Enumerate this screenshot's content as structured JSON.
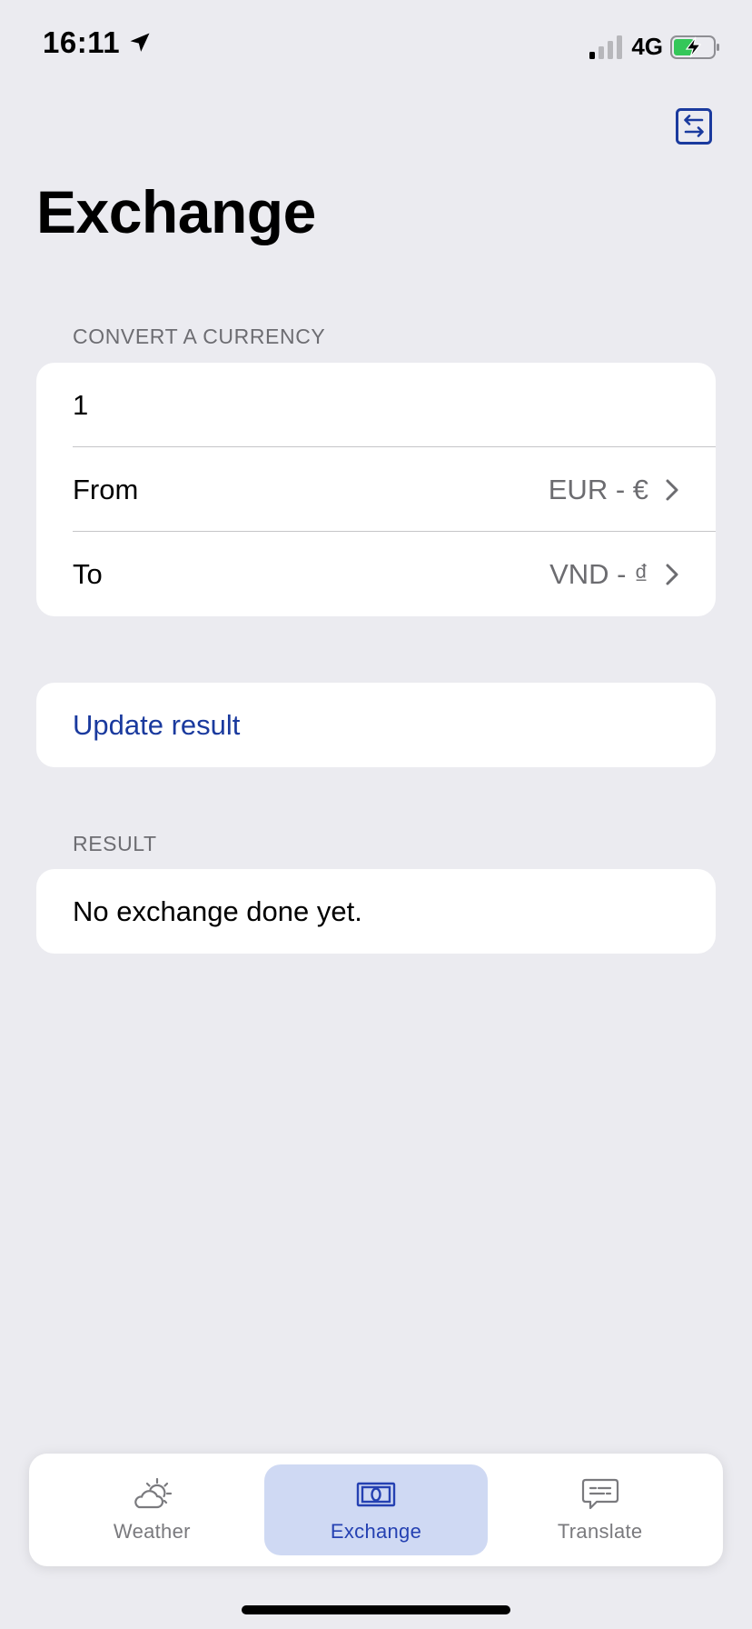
{
  "status_bar": {
    "time": "16:11",
    "network": "4G",
    "battery_color": "#34c759"
  },
  "icons": {
    "location": "location-arrow-icon",
    "signal": "cellular-signal-icon",
    "battery": "battery-charging-icon",
    "swap": "swap-currencies-icon",
    "weather": "partly-sunny-icon",
    "exchange": "banknote-icon",
    "translate": "speech-bubble-icon"
  },
  "header": {
    "title": "Exchange"
  },
  "convert_section": {
    "header": "CONVERT A CURRENCY",
    "amount_value": "1",
    "from_label": "From",
    "from_value": "EUR - €",
    "to_label": "To",
    "to_value": "VND - ₫"
  },
  "update": {
    "label": "Update result"
  },
  "result_section": {
    "header": "RESULT",
    "text": "No exchange done yet."
  },
  "tab_bar": {
    "tabs": [
      {
        "label": "Weather",
        "active": false
      },
      {
        "label": "Exchange",
        "active": true
      },
      {
        "label": "Translate",
        "active": false
      }
    ]
  },
  "colors": {
    "accent": "#1a3a9e",
    "active_tab_bg": "#cfd9f3",
    "active_tab_fg": "#2541b2",
    "background": "#ebebf0"
  }
}
